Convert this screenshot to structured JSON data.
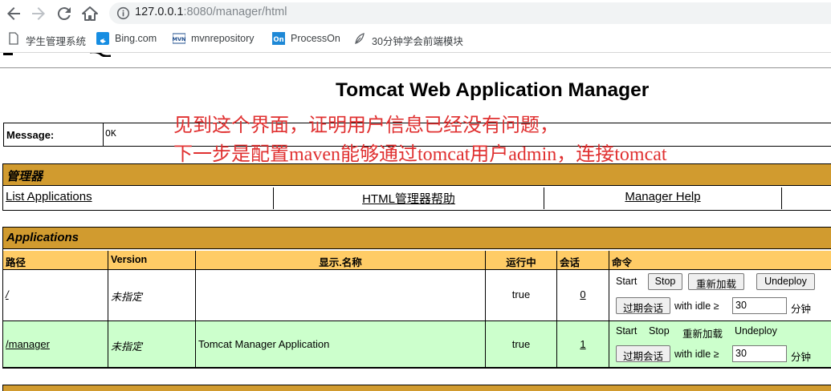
{
  "browser": {
    "url_host": "127.0.0.1",
    "url_rest": ":8080/manager/html",
    "bookmarks": [
      {
        "label": "学生管理系统",
        "icon": "page-icon"
      },
      {
        "label": "Bing.com",
        "icon": "bing-icon"
      },
      {
        "label": "mvnrepository",
        "icon": "mvn-icon"
      },
      {
        "label": "ProcessOn",
        "icon": "processon-icon"
      },
      {
        "label": "30分钟学会前端模块",
        "icon": "leaf-icon"
      }
    ]
  },
  "page": {
    "title": "Tomcat Web Application Manager",
    "message_label": "Message:",
    "message_value": "OK",
    "overlay_line1": "见到这个界面，证明用户信息已经没有问题，",
    "overlay_line2": "下一步是配置maven能够通过tomcat用户admin，连接tomcat",
    "overlay_color": "#e03030",
    "manager_heading": "管理器",
    "manager_links": [
      "List Applications",
      "HTML管理器帮助",
      "Manager Help"
    ],
    "applications_heading": "Applications",
    "columns": [
      "路径",
      "Version",
      "显示.名称",
      "运行中",
      "会话",
      "命令"
    ],
    "apps": [
      {
        "path": "/",
        "version": "未指定",
        "display_name": "",
        "running": "true",
        "sessions": "0",
        "start": "Start",
        "stop": "Stop",
        "reload": "重新加载",
        "undeploy": "Undeploy",
        "expire": "过期会话",
        "with_idle": "with idle ≥",
        "idle_value": "30",
        "minutes": "分钟"
      },
      {
        "path": "/manager",
        "version": "未指定",
        "display_name": "Tomcat Manager Application",
        "running": "true",
        "sessions": "1",
        "start": "Start",
        "stop": "Stop",
        "reload": "重新加载",
        "undeploy": "Undeploy",
        "expire": "过期会话",
        "with_idle": "with idle ≥",
        "idle_value": "30",
        "minutes": "分钟"
      }
    ]
  }
}
